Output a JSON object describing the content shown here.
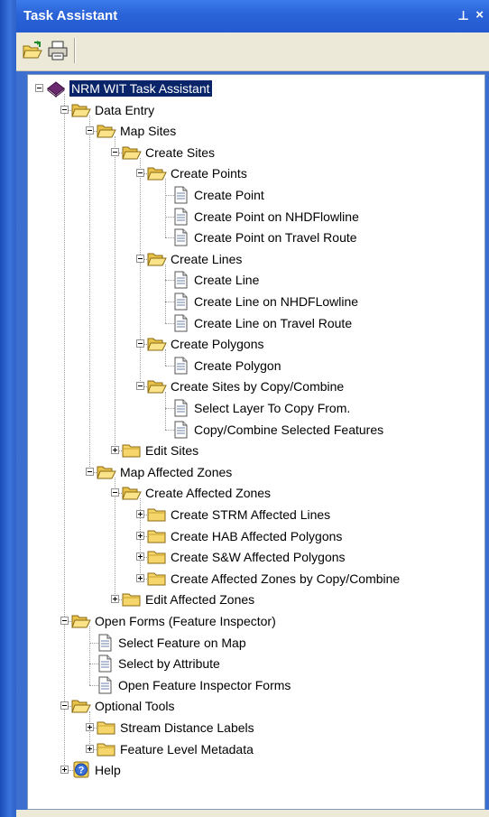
{
  "window": {
    "title": "Task Assistant",
    "pin_glyph": "⊥",
    "close_glyph": "×"
  },
  "toolbar": {
    "buttons": [
      {
        "name": "open-folder-icon"
      },
      {
        "name": "print-icon"
      }
    ]
  },
  "tree": [
    {
      "label": "NRM WIT Task Assistant",
      "depth": 0,
      "icon": "book-icon",
      "expander": "minus",
      "selected": true
    },
    {
      "label": "Data Entry",
      "depth": 1,
      "icon": "folder-open-icon",
      "expander": "minus"
    },
    {
      "label": "Map Sites",
      "depth": 2,
      "icon": "folder-open-icon",
      "expander": "minus"
    },
    {
      "label": "Create Sites",
      "depth": 3,
      "icon": "folder-open-icon",
      "expander": "minus"
    },
    {
      "label": "Create Points",
      "depth": 4,
      "icon": "folder-open-icon",
      "expander": "minus"
    },
    {
      "label": "Create Point",
      "depth": 5,
      "icon": "document-icon",
      "expander": "none"
    },
    {
      "label": "Create Point on NHDFlowline",
      "depth": 5,
      "icon": "document-icon",
      "expander": "none"
    },
    {
      "label": "Create Point on Travel Route",
      "depth": 5,
      "icon": "document-icon",
      "expander": "none"
    },
    {
      "label": "Create Lines",
      "depth": 4,
      "icon": "folder-open-icon",
      "expander": "minus"
    },
    {
      "label": "Create Line",
      "depth": 5,
      "icon": "document-icon",
      "expander": "none"
    },
    {
      "label": "Create Line on NHDFLowline",
      "depth": 5,
      "icon": "document-icon",
      "expander": "none"
    },
    {
      "label": "Create Line on Travel Route",
      "depth": 5,
      "icon": "document-icon",
      "expander": "none"
    },
    {
      "label": "Create Polygons",
      "depth": 4,
      "icon": "folder-open-icon",
      "expander": "minus"
    },
    {
      "label": "Create Polygon",
      "depth": 5,
      "icon": "document-icon",
      "expander": "none"
    },
    {
      "label": "Create Sites by Copy/Combine",
      "depth": 4,
      "icon": "folder-open-icon",
      "expander": "minus"
    },
    {
      "label": "Select Layer To Copy From.",
      "depth": 5,
      "icon": "document-icon",
      "expander": "none"
    },
    {
      "label": "Copy/Combine Selected Features",
      "depth": 5,
      "icon": "document-icon",
      "expander": "none"
    },
    {
      "label": "Edit Sites",
      "depth": 3,
      "icon": "folder-closed-icon",
      "expander": "plus"
    },
    {
      "label": "Map Affected Zones",
      "depth": 2,
      "icon": "folder-open-icon",
      "expander": "minus"
    },
    {
      "label": "Create Affected Zones",
      "depth": 3,
      "icon": "folder-open-icon",
      "expander": "minus"
    },
    {
      "label": "Create STRM Affected Lines",
      "depth": 4,
      "icon": "folder-closed-icon",
      "expander": "plus"
    },
    {
      "label": "Create HAB Affected Polygons",
      "depth": 4,
      "icon": "folder-closed-icon",
      "expander": "plus"
    },
    {
      "label": "Create S&W Affected Polygons",
      "depth": 4,
      "icon": "folder-closed-icon",
      "expander": "plus"
    },
    {
      "label": "Create Affected Zones by Copy/Combine",
      "depth": 4,
      "icon": "folder-closed-icon",
      "expander": "plus"
    },
    {
      "label": "Edit Affected Zones",
      "depth": 3,
      "icon": "folder-closed-icon",
      "expander": "plus"
    },
    {
      "label": "Open Forms (Feature Inspector)",
      "depth": 1,
      "icon": "folder-open-icon",
      "expander": "minus"
    },
    {
      "label": "Select Feature on Map",
      "depth": 2,
      "icon": "document-icon",
      "expander": "none"
    },
    {
      "label": "Select by Attribute",
      "depth": 2,
      "icon": "document-icon",
      "expander": "none"
    },
    {
      "label": "Open Feature Inspector Forms",
      "depth": 2,
      "icon": "document-icon",
      "expander": "none"
    },
    {
      "label": "Optional Tools",
      "depth": 1,
      "icon": "folder-open-icon",
      "expander": "minus"
    },
    {
      "label": "Stream Distance Labels",
      "depth": 2,
      "icon": "folder-closed-icon",
      "expander": "plus"
    },
    {
      "label": "Feature Level Metadata",
      "depth": 2,
      "icon": "folder-closed-icon",
      "expander": "plus"
    },
    {
      "label": "Help",
      "depth": 1,
      "icon": "help-icon",
      "expander": "plus"
    }
  ]
}
